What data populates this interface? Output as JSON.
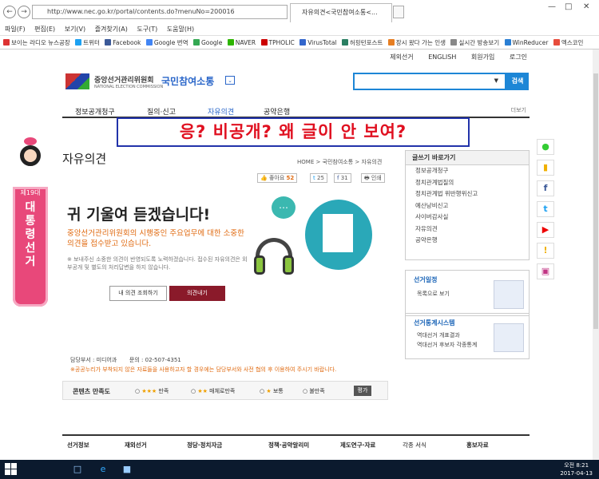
{
  "browser": {
    "url": "http://www.nec.go.kr/portal/contents.do?menuNo=200016",
    "tab_title": "자유의견<국민참여소통<...",
    "menu": [
      "파일(F)",
      "편집(E)",
      "보기(V)",
      "즐겨찾기(A)",
      "도구(T)",
      "도움말(H)"
    ],
    "favorites": [
      "보이는 라디오 뉴스공장",
      "트위터",
      "Facebook",
      "Google 번역",
      "Google",
      "NAVER",
      "TPHOLIC",
      "VirusTotal",
      "허핑턴포스트",
      "장시 왔다 가는 인생",
      "실시간 방송보기",
      "WinReducer",
      "엑스코인"
    ]
  },
  "header": {
    "top_links": [
      "제외선거",
      "ENGLISH",
      "회원가입",
      "로그인"
    ],
    "org_name": "중앙선거관리위원회",
    "org_sub": "NATIONAL ELECTION COMMISSION",
    "section": "국민참여소통",
    "search_button": "검색"
  },
  "gnb": {
    "items": [
      "정보공개청구",
      "질의·신고",
      "자유의견",
      "공약은행"
    ],
    "more": "더보기"
  },
  "overlay_text": "응? 비공개? 왜 글이 안 보여?",
  "banner": {
    "label": "제19대",
    "text": "대통령선거"
  },
  "page": {
    "title": "자유의견",
    "breadcrumb": "HOME > 국민참여소통 > 자유의견",
    "likes_label": "좋아요",
    "likes_count": "52",
    "twitter_count": "25",
    "facebook_count": "31",
    "print_label": "인쇄"
  },
  "hero": {
    "title": "귀 기울여 듣겠습니다!",
    "desc": "중앙선거관리위원회의 시행중인 주요업무에 대한 소중한 의견을 접수받고 있습니다.",
    "note": "※ 보내주신 소중한 의견이 반영되도록 노력하겠습니다. 접수된 자유의견은 외부공개 및 별도의 처리답변을 하지 않습니다.",
    "my_view": "내 의견 조회하기",
    "submit": "의견내기"
  },
  "right": {
    "title": "글쓰기 바로가기",
    "items": [
      "정보공개청구",
      "정치관계법질의",
      "정치관계법 위반행위신고",
      "예산낭비신고",
      "사이버감사실",
      "자유의견",
      "공약은행"
    ],
    "schedule_title": "선거일정",
    "schedule_link": "목록으로 보기",
    "stats_title": "선거통계시스템",
    "stats_links": [
      "역대선거 개표결과",
      "역대선거 후보자 각종통계"
    ]
  },
  "info": {
    "dept": "담당부서 : 미디어과",
    "phone": "문의 : 02-507-4351",
    "note": "※공공누리가 부착되지 않은 자료들을 사용하고자 할 경우에는 담당부서와 사전 협의 후 이용하여 주시기 바랍니다."
  },
  "survey": {
    "label": "콘텐츠 만족도",
    "options": [
      "만족",
      "매체로만족",
      "보통",
      "불만족"
    ],
    "button": "평가"
  },
  "footer": [
    "선거정보",
    "재외선거",
    "정당·정치자금",
    "정책·공약알리미",
    "제도연구·자료",
    "각종 서식",
    "홍보자료"
  ],
  "taskbar": {
    "time": "오전 8:21",
    "date": "2017-04-13"
  },
  "social": [
    "kakao-icon",
    "bookmark-icon",
    "facebook-icon",
    "twitter-icon",
    "youtube-icon",
    "notice-icon",
    "instagram-icon"
  ]
}
